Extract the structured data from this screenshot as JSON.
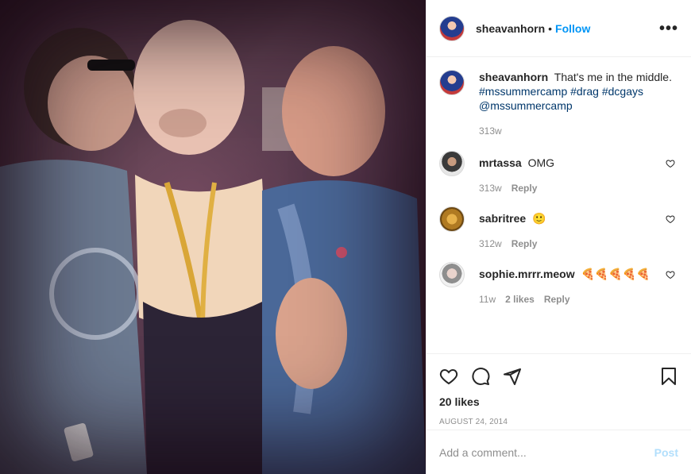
{
  "post": {
    "username": "sheavanhorn",
    "follow_label": "Follow",
    "header_dot": "•",
    "more_label": "•••",
    "caption": {
      "username": "sheavanhorn",
      "text": "That's me in the middle.",
      "tags": [
        "#mssummercamp",
        "#drag",
        "#dcgays",
        "@mssummercamp"
      ],
      "time": "313w"
    },
    "comments": [
      {
        "username": "mrtassa",
        "text": "OMG",
        "time": "313w",
        "likes": "",
        "reply": "Reply",
        "avatar_icon": "avatar"
      },
      {
        "username": "sabritree",
        "text": "🙂",
        "time": "312w",
        "likes": "",
        "reply": "Reply",
        "avatar_icon": "avatar"
      },
      {
        "username": "sophie.mrrr.meow",
        "text": "🍕🍕🍕🍕🍕",
        "time": "11w",
        "likes": "2 likes",
        "reply": "Reply",
        "avatar_icon": "avatar"
      }
    ],
    "likes_label": "20 likes",
    "date": "AUGUST 24, 2014",
    "add_comment_placeholder": "Add a comment...",
    "post_label": "Post",
    "icons": {
      "like": "heart-icon",
      "comment": "comment-icon",
      "share": "paper-plane-icon",
      "save": "bookmark-icon"
    },
    "colors": {
      "link": "#0095f6",
      "hashtag": "#00376b",
      "muted": "#8e8e8e",
      "post_disabled": "#b2dffc"
    }
  }
}
